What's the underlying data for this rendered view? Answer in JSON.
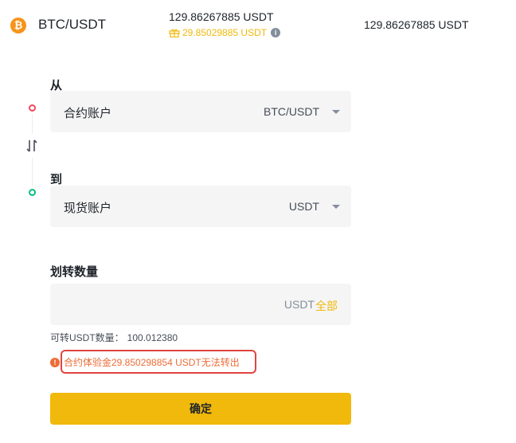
{
  "header": {
    "coin_symbol": "₿",
    "pair": "BTC/USDT",
    "balance_main": "129.86267885 USDT",
    "balance_bonus": "29.85029885 USDT",
    "balance_right": "129.86267885 USDT"
  },
  "transfer": {
    "from_label": "从",
    "from_account": "合约账户",
    "from_value": "BTC/USDT",
    "to_label": "到",
    "to_account": "现货账户",
    "to_value": "USDT",
    "amount_label": "划转数量",
    "amount_value": "",
    "amount_unit": "USDT",
    "amount_all": "全部",
    "available_label": "可转USDT数量：",
    "available_value": "100.012380",
    "warning_text": "合约体验金29.850298854 USDT无法转出",
    "confirm_label": "确定"
  },
  "colors": {
    "accent": "#f0b90b",
    "warning": "#ed6c36",
    "highlight_border": "#e0443e",
    "from_dot": "#f6465d",
    "to_dot": "#02c076"
  },
  "icons": [
    "bitcoin-icon",
    "gift-icon",
    "info-icon",
    "swap-icon",
    "caret-down-icon",
    "warning-icon"
  ]
}
